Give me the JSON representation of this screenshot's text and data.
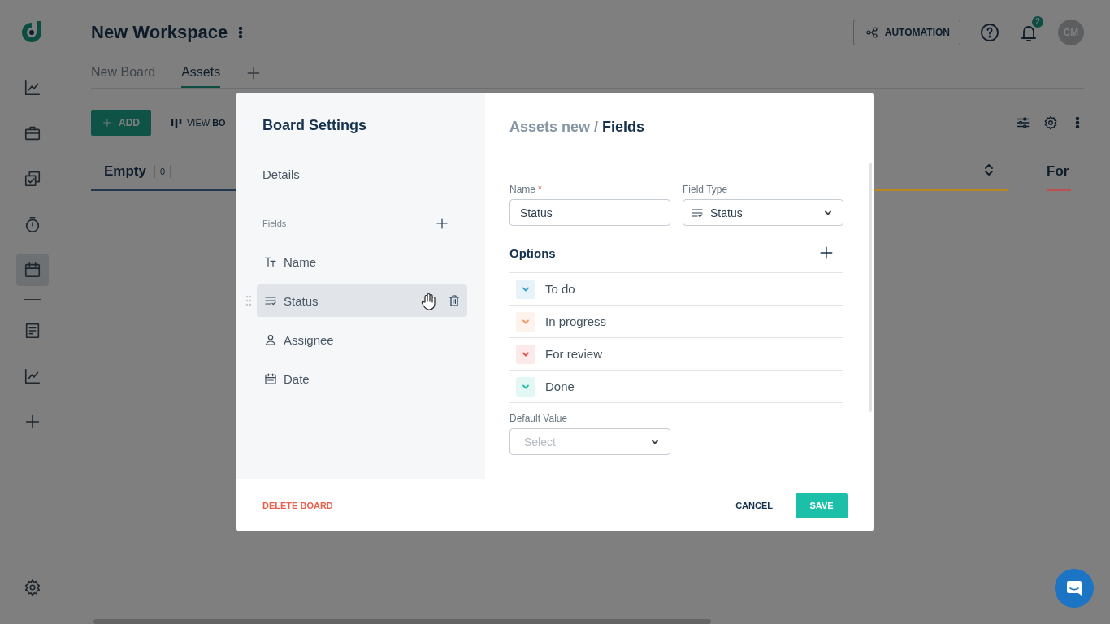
{
  "sidebar": {
    "groups": [
      [
        {
          "kind": "chart",
          "selected": false
        },
        {
          "kind": "briefcase",
          "selected": false
        },
        {
          "kind": "tasks",
          "selected": false
        },
        {
          "kind": "timer",
          "selected": false
        },
        {
          "kind": "calendar",
          "selected": true
        }
      ],
      [
        {
          "kind": "document",
          "selected": false
        },
        {
          "kind": "chart",
          "selected": false
        },
        {
          "kind": "add",
          "selected": false
        }
      ]
    ]
  },
  "header": {
    "title": "New Workspace",
    "automation_button": "AUTOMATION",
    "notification_count": "2",
    "avatar_initials": "CM"
  },
  "tabs": [
    {
      "label": "New Board",
      "selected": false
    },
    {
      "label": "Assets",
      "selected": true
    }
  ],
  "toolbar": {
    "add_button": "ADD",
    "view_button": "VIEW **BO**"
  },
  "columns": [
    {
      "title": "Empty",
      "count": "0",
      "color": "#22384f"
    },
    {
      "color": "#b8861c"
    },
    {
      "title": "For",
      "color": "#c0504f"
    }
  ],
  "modal": {
    "title": "Board Settings",
    "nav": {
      "details": "Details",
      "fields_label": "Fields"
    },
    "fields": [
      {
        "label": "Name",
        "kind": "text",
        "selected": false
      },
      {
        "label": "Status",
        "kind": "status",
        "selected": true
      },
      {
        "label": "Assignee",
        "kind": "person",
        "selected": false
      },
      {
        "label": "Date",
        "kind": "date",
        "selected": false
      }
    ],
    "breadcrumb": {
      "parent": "Assets new /",
      "current": "Fields"
    },
    "name_field": {
      "label": "Name",
      "required_mark": "*",
      "value": "Status"
    },
    "field_type": {
      "label": "Field Type",
      "value": "Status"
    },
    "options_title": "Options",
    "options": [
      {
        "label": "To do",
        "color": "#3a9fc4"
      },
      {
        "label": "In progress",
        "color": "#f2925f"
      },
      {
        "label": "For review",
        "color": "#e2534c"
      },
      {
        "label": "Done",
        "color": "#1bbfa6"
      }
    ],
    "default_value": {
      "label": "Default Value",
      "placeholder": "Select"
    },
    "delete_button": "DELETE BOARD",
    "cancel_button": "CANCEL",
    "save_button": "SAVE"
  }
}
